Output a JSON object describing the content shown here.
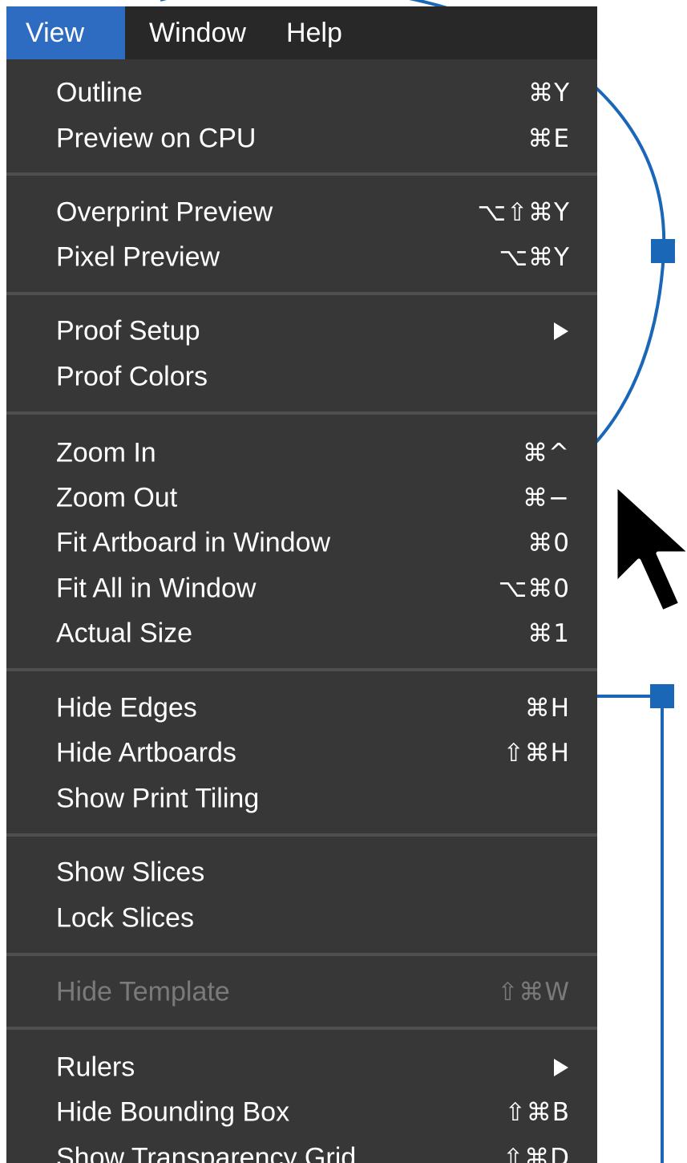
{
  "colors": {
    "menubar_bg": "#282828",
    "menu_bg": "#373737",
    "active_tab": "#2d6cc0",
    "separator": "#4f4f4f",
    "text": "#ffffff",
    "disabled_text": "#7a7a7a",
    "annotation_blue": "#1a67b8"
  },
  "menubar": {
    "items": [
      {
        "label": "View",
        "active": true
      },
      {
        "label": "Window",
        "active": false
      },
      {
        "label": "Help",
        "active": false
      }
    ]
  },
  "menu": {
    "groups": [
      [
        {
          "label": "Outline",
          "shortcut": "⌘Y"
        },
        {
          "label": "Preview on CPU",
          "shortcut": "⌘E"
        }
      ],
      [
        {
          "label": "Overprint Preview",
          "shortcut": "⌥⇧⌘Y"
        },
        {
          "label": "Pixel Preview",
          "shortcut": "⌥⌘Y"
        }
      ],
      [
        {
          "label": "Proof Setup",
          "submenu": true
        },
        {
          "label": "Proof Colors"
        }
      ],
      [
        {
          "label": "Zoom In",
          "shortcut": "⌘^"
        },
        {
          "label": "Zoom Out",
          "shortcut": "⌘−"
        },
        {
          "label": "Fit Artboard in Window",
          "shortcut": "⌘0"
        },
        {
          "label": "Fit All in Window",
          "shortcut": "⌥⌘0"
        },
        {
          "label": "Actual Size",
          "shortcut": "⌘1"
        }
      ],
      [
        {
          "label": "Hide Edges",
          "shortcut": "⌘H"
        },
        {
          "label": "Hide Artboards",
          "shortcut": "⇧⌘H"
        },
        {
          "label": "Show Print Tiling"
        }
      ],
      [
        {
          "label": "Show Slices"
        },
        {
          "label": "Lock Slices"
        }
      ],
      [
        {
          "label": "Hide Template",
          "shortcut": "⇧⌘W",
          "disabled": true
        }
      ],
      [
        {
          "label": "Rulers",
          "submenu": true
        },
        {
          "label": "Hide Bounding Box",
          "shortcut": "⇧⌘B"
        },
        {
          "label": "Show Transparency Grid",
          "shortcut": "⇧⌘D"
        }
      ]
    ]
  }
}
